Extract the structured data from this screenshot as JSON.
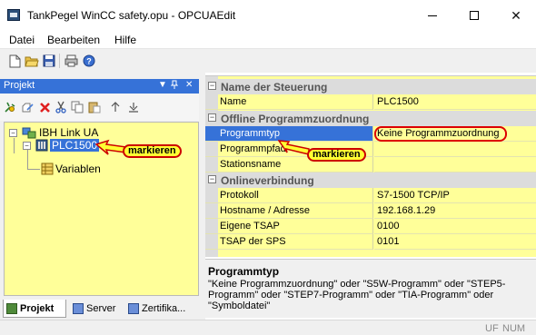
{
  "window": {
    "title": "TankPegel WinCC safety.opu - OPCUAEdit",
    "minimize_label": "—",
    "close_label": "✕"
  },
  "menu": [
    "Datei",
    "Bearbeiten",
    "Hilfe"
  ],
  "toolbar": {
    "icons": [
      "new-file-icon",
      "open-folder-icon",
      "save-icon",
      "print-icon",
      "help-icon"
    ]
  },
  "left_panel": {
    "title": "Projekt",
    "controls": [
      "▼",
      "⊅",
      "✕"
    ],
    "toolbar_icons": [
      "add-connection-icon",
      "edit-icon",
      "delete-icon",
      "cut-icon",
      "copy-icon",
      "paste-icon",
      "move-up-icon",
      "move-down-icon"
    ],
    "tree": [
      {
        "label": "IBH Link UA",
        "expander": "−"
      },
      {
        "label": "PLC1500",
        "expander": "−"
      },
      {
        "label": "Variablen"
      }
    ],
    "callout_tree": "markieren",
    "tabs": [
      "Projekt",
      "Server",
      "Zertifika..."
    ]
  },
  "grid": {
    "categories": [
      {
        "label": "Name der Steuerung",
        "expander": "−",
        "rows": [
          {
            "name": "Name",
            "value": "PLC1500"
          }
        ]
      },
      {
        "label": "Offline Programmzuordnung",
        "expander": "−",
        "rows": [
          {
            "name": "Programmtyp",
            "value": "Keine Programmzuordnung"
          },
          {
            "name": "Programmpfad",
            "value": ""
          },
          {
            "name": "Stationsname",
            "value": ""
          }
        ]
      },
      {
        "label": "Onlineverbindung",
        "expander": "−",
        "rows": [
          {
            "name": "Protokoll",
            "value": "S7-1500 TCP/IP"
          },
          {
            "name": "Hostname / Adresse",
            "value": "192.168.1.29"
          },
          {
            "name": "Eigene TSAP",
            "value": "0100"
          },
          {
            "name": "TSAP der SPS",
            "value": "0101"
          }
        ]
      }
    ],
    "callout_grid": "markieren"
  },
  "description": {
    "title": "Programmtyp",
    "text": "\"Keine Programmzuordnung\" oder \"S5W-Programm\" oder \"STEP5-Programm\" oder \"STEP7-Programm\" oder \"TIA-Programm\" oder \"Symboldatei\""
  },
  "status": {
    "indicators": [
      "UF",
      "NUM"
    ]
  },
  "colors": {
    "accent": "#3672d8",
    "grid_background": "#ffff99",
    "callout_background": "#ffff33",
    "callout_border": "#cc0000"
  }
}
